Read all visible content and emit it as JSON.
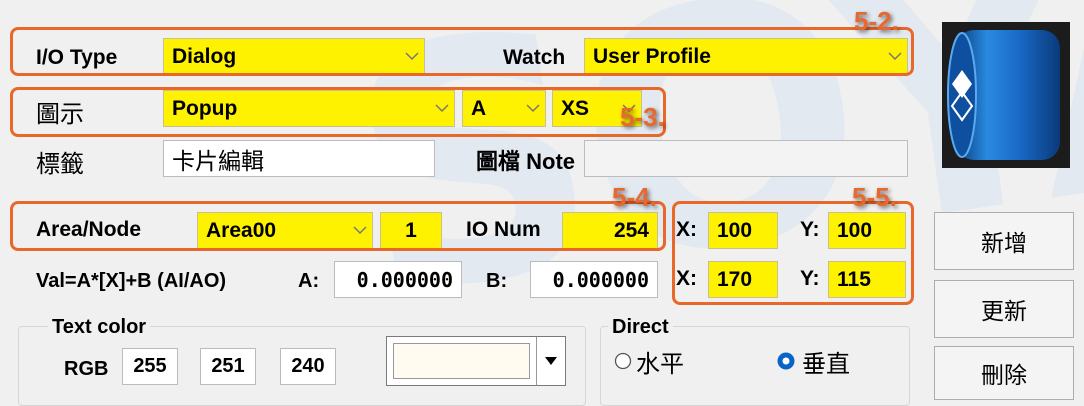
{
  "watermark": "SOYAL",
  "callouts": [
    "5-2.",
    "5-3.",
    "5-4.",
    "5-5."
  ],
  "row1": {
    "io_type_label": "I/O Type",
    "io_type_value": "Dialog",
    "watch_label": "Watch",
    "watch_value": "User Profile"
  },
  "row2": {
    "icon_label": "圖示",
    "icon_value": "Popup",
    "letter_value": "A",
    "size_value": "XS"
  },
  "row3": {
    "tag_label": "標籤",
    "tag_value": "卡片編輯",
    "image_note_label": "圖檔 Note",
    "image_note_value": ""
  },
  "row4": {
    "area_node_label": "Area/Node",
    "area_value": "Area00",
    "node_value": "1",
    "io_num_label": "IO Num",
    "io_num_value": "254"
  },
  "coords": {
    "x_label": "X:",
    "y_label": "Y:",
    "x1": "100",
    "y1": "100",
    "x2": "170",
    "y2": "115"
  },
  "formula": {
    "label": "Val=A*[X]+B (AI/AO)",
    "a_label": "A:",
    "a_value": "0.000000",
    "b_label": "B:",
    "b_value": "0.000000"
  },
  "text_color": {
    "group_label": "Text color",
    "rgb_label": "RGB",
    "r": "255",
    "g": "251",
    "b": "240",
    "swatch": "#fffbf0"
  },
  "direct": {
    "group_label": "Direct",
    "horizontal_label": "水平",
    "vertical_label": "垂直",
    "selected": "vertical"
  },
  "buttons": {
    "add": "新增",
    "update": "更新",
    "delete": "刪除"
  },
  "colors": {
    "highlight": "#fff200",
    "callout": "#e9682d",
    "icon_blue": "#1565c0"
  },
  "icons": {
    "preview": "cylinder-icon",
    "dropdown": "chevron-down-icon",
    "radio": "radio-icon"
  }
}
